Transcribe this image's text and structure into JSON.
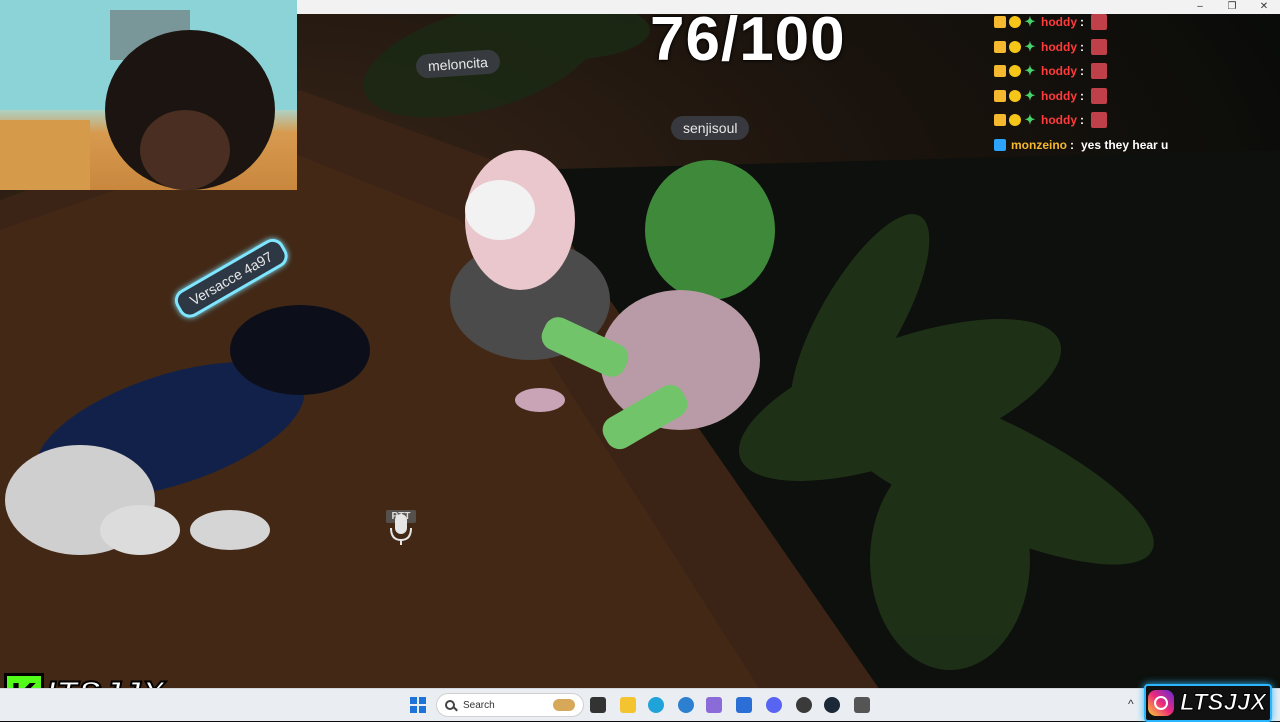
{
  "window": {
    "minimize": "–",
    "restore": "❐",
    "close": "✕"
  },
  "scene": {
    "counter": "76/100",
    "nameplates": {
      "versacce": "Versacce 4a97",
      "meloncita": "meloncita",
      "senjisoul": "senjisoul"
    },
    "ptt_label": "PTT"
  },
  "chat": {
    "lines": [
      {
        "user": "hoddy",
        "sep": ":",
        "message": "",
        "color": "#ff3b3b"
      },
      {
        "user": "hoddy",
        "sep": ":",
        "message": "",
        "color": "#ff3b3b"
      },
      {
        "user": "hoddy",
        "sep": ":",
        "message": "",
        "color": "#ff3b3b"
      },
      {
        "user": "hoddy",
        "sep": ":",
        "message": "",
        "color": "#ff3b3b"
      },
      {
        "user": "hoddy",
        "sep": ":",
        "message": "",
        "color": "#ff3b3b"
      },
      {
        "user": "monzeino",
        "sep": ":",
        "message": "yes they hear u",
        "color": "#f5b82e"
      }
    ]
  },
  "branding": {
    "kick_name": "ITSJJX",
    "kick_letter": "K",
    "ig_name": "LTSJJX"
  },
  "taskbar": {
    "search_placeholder": "Search",
    "apps": [
      "task-view-icon",
      "file-explorer-icon",
      "edge-icon",
      "copilot-icon",
      "gallery-icon",
      "store-icon",
      "discord-icon",
      "chrome-icon",
      "steam-icon",
      "vr-icon"
    ],
    "tray_chevron": "^"
  },
  "colors": {
    "accent_kick": "#53fc18",
    "nameplate_highlight": "#7fe6ff",
    "chat_user_red": "#ff3b3b",
    "chat_user_gold": "#f5b82e"
  }
}
